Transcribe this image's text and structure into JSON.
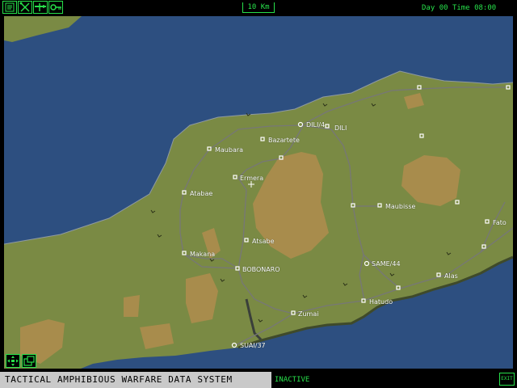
{
  "toolbar": {
    "buttons": [
      {
        "name": "notes-icon"
      },
      {
        "name": "crossed-tools-icon"
      },
      {
        "name": "aircraft-icon"
      },
      {
        "name": "key-icon"
      }
    ]
  },
  "scale_label": "10 Km",
  "clock": {
    "day_label": "Day",
    "day": "00",
    "time_label": "Time",
    "time": "08:00"
  },
  "map": {
    "colors": {
      "sea": "#2d4f80",
      "land": "#7a8a44",
      "highland": "#a88c4c",
      "coast": "#8e9aa2",
      "road": "#777777",
      "marker": "#ffffff"
    },
    "cities": [
      {
        "name": "DILI/4",
        "type": "airfield"
      },
      {
        "name": "DILI",
        "type": "port"
      },
      {
        "name": "Bazartete",
        "type": "town"
      },
      {
        "name": "Maubara",
        "type": "town"
      },
      {
        "name": "Ermera",
        "type": "town"
      },
      {
        "name": "Atabae",
        "type": "town"
      },
      {
        "name": "Maubisse",
        "type": "town"
      },
      {
        "name": "Atsabe",
        "type": "town"
      },
      {
        "name": "Makana",
        "type": "town"
      },
      {
        "name": "BOBONARO",
        "type": "town"
      },
      {
        "name": "SAME/44",
        "type": "airfield"
      },
      {
        "name": "Alas",
        "type": "town"
      },
      {
        "name": "Hatudo",
        "type": "town"
      },
      {
        "name": "Zumai",
        "type": "town"
      },
      {
        "name": "SUAI/37",
        "type": "airfield"
      },
      {
        "name": "Fato",
        "type": "town"
      }
    ]
  },
  "nav_buttons": [
    {
      "name": "pan-arrows-icon"
    },
    {
      "name": "window-icon"
    }
  ],
  "footer": {
    "system_title": "TACTICAL AMPHIBIOUS WARFARE DATA SYSTEM",
    "status": "INACTIVE",
    "exit_label": "EXIT"
  }
}
